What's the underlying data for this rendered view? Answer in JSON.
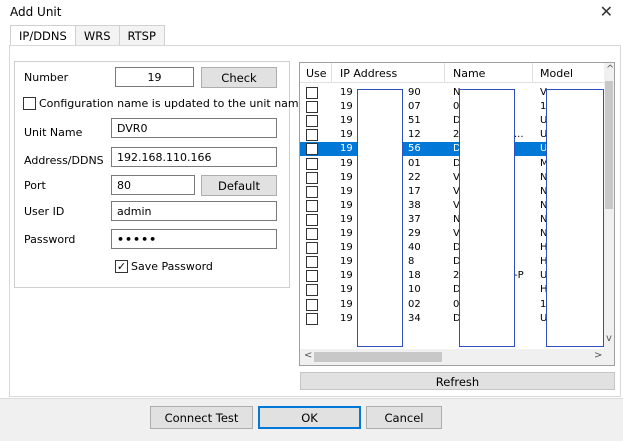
{
  "window": {
    "title": "Add Unit",
    "close_glyph": "✕"
  },
  "tabs": [
    {
      "label": "IP/DDNS",
      "active": true
    },
    {
      "label": "WRS",
      "active": false
    },
    {
      "label": "RTSP",
      "active": false
    }
  ],
  "form": {
    "number_label": "Number",
    "number_value": "19",
    "check_button": "Check",
    "config_name_checkbox_label": "Configuration name is updated to the unit name",
    "config_name_checked": false,
    "unit_name_label": "Unit Name",
    "unit_name_value": "DVR0",
    "address_label": "Address/DDNS",
    "address_value": "192.168.110.166",
    "port_label": "Port",
    "port_value": "80",
    "default_button": "Default",
    "user_id_label": "User ID",
    "user_id_value": "admin",
    "password_label": "Password",
    "password_value": "•••••",
    "save_password_label": "Save Password",
    "save_password_checked": true,
    "check_glyph": "✓"
  },
  "table": {
    "headers": [
      "Use",
      "IP Address",
      "Name",
      "Model"
    ],
    "selected_row_index": 4,
    "rows": [
      {
        "ip_l": "19",
        "ip_r": "90",
        "name_l": "N",
        "name_r": "",
        "model": "V"
      },
      {
        "ip_l": "19",
        "ip_r": "07",
        "name_l": "0",
        "name_r": "",
        "model": "1"
      },
      {
        "ip_l": "19",
        "ip_r": "51",
        "name_l": "D",
        "name_r": "",
        "model": "U"
      },
      {
        "ip_l": "19",
        "ip_r": "12",
        "name_l": "2",
        "name_r": "...",
        "model": "U"
      },
      {
        "ip_l": "19",
        "ip_r": "56",
        "name_l": "D",
        "name_r": "",
        "model": "U"
      },
      {
        "ip_l": "19",
        "ip_r": "01",
        "name_l": "D",
        "name_r": "",
        "model": "M"
      },
      {
        "ip_l": "19",
        "ip_r": "22",
        "name_l": "V",
        "name_r": "",
        "model": "N"
      },
      {
        "ip_l": "19",
        "ip_r": "17",
        "name_l": "V",
        "name_r": "",
        "model": "N"
      },
      {
        "ip_l": "19",
        "ip_r": "38",
        "name_l": "V",
        "name_r": "",
        "model": "N"
      },
      {
        "ip_l": "19",
        "ip_r": "37",
        "name_l": "N",
        "name_r": "",
        "model": "N"
      },
      {
        "ip_l": "19",
        "ip_r": "29",
        "name_l": "V",
        "name_r": "",
        "model": "N"
      },
      {
        "ip_l": "19",
        "ip_r": "40",
        "name_l": "D",
        "name_r": "",
        "model": "H"
      },
      {
        "ip_l": "19",
        "ip_r": "8",
        "name_l": "D",
        "name_r": "",
        "model": "H"
      },
      {
        "ip_l": "19",
        "ip_r": "18",
        "name_l": "2",
        "name_r": "-P",
        "model": "U"
      },
      {
        "ip_l": "19",
        "ip_r": "10",
        "name_l": "D",
        "name_r": "",
        "model": "H"
      },
      {
        "ip_l": "19",
        "ip_r": "02",
        "name_l": "0",
        "name_r": "",
        "model": "1"
      },
      {
        "ip_l": "19",
        "ip_r": "34",
        "name_l": "D",
        "name_r": "",
        "model": "U"
      }
    ],
    "scroll_left_glyph": "<",
    "scroll_right_glyph": ">",
    "scroll_up_glyph": "^",
    "scroll_down_glyph": "v",
    "refresh_button": "Refresh"
  },
  "footer": {
    "connect_test_button": "Connect Test",
    "ok_button": "OK",
    "cancel_button": "Cancel"
  },
  "colors": {
    "selection": "#0078d7",
    "redaction_border": "#2f4fbf"
  }
}
